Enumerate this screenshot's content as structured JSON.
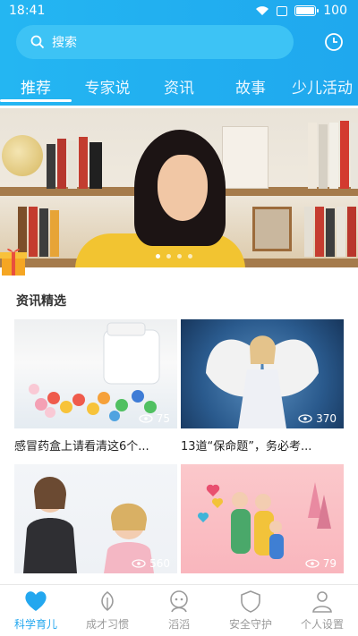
{
  "status": {
    "time": "18:41",
    "battery": "100",
    "battery_level": 1.0
  },
  "search": {
    "placeholder": "搜索"
  },
  "tabs": [
    "推荐",
    "专家说",
    "资讯",
    "故事",
    "少儿活动"
  ],
  "section": {
    "title": "资讯精选"
  },
  "cards": [
    {
      "title": "感冒药盒上请看清这6个...",
      "views": "75"
    },
    {
      "title": "13道“保命题”，务必考...",
      "views": "370"
    },
    {
      "title": "",
      "views": "560"
    },
    {
      "title": "",
      "views": "79"
    }
  ],
  "bottom_nav": [
    {
      "label": "科学育儿",
      "icon": "heart-icon",
      "active": true
    },
    {
      "label": "成才习惯",
      "icon": "leaf-icon",
      "active": false
    },
    {
      "label": "滔滔",
      "icon": "mascot-icon",
      "active": false
    },
    {
      "label": "安全守护",
      "icon": "shield-icon",
      "active": false
    },
    {
      "label": "个人设置",
      "icon": "user-icon",
      "active": false
    }
  ],
  "colors": {
    "accent": "#23a7ef",
    "header": "#1fa8ee"
  }
}
